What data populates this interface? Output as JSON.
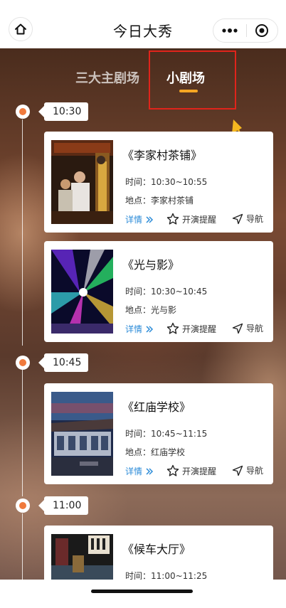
{
  "header": {
    "title": "今日大秀",
    "home_icon": "home-icon",
    "more_icon": "more-dots-icon",
    "close_icon": "target-close-icon"
  },
  "tabs": {
    "main_label": "三大主剧场",
    "small_label": "小剧场",
    "active": "small",
    "accent": "#f5a623"
  },
  "annotation": {
    "box_color": "#e0241b",
    "arrow_color": "#f5b820"
  },
  "timeline": {
    "slots": [
      {
        "time": "10:30"
      },
      {
        "time": "10:45"
      },
      {
        "time": "11:00"
      }
    ]
  },
  "shows": [
    {
      "title": "《李家村茶铺》",
      "time_label": "时间：",
      "time_value": "10:30~10:55",
      "place_label": "地点：",
      "place_value": "李家村茶铺",
      "detail": "详情",
      "remind": "开演提醒",
      "navigate": "导航"
    },
    {
      "title": "《光与影》",
      "time_label": "时间：",
      "time_value": "10:30~10:45",
      "place_label": "地点：",
      "place_value": "光与影",
      "detail": "详情",
      "remind": "开演提醒",
      "navigate": "导航"
    },
    {
      "title": "《红庙学校》",
      "time_label": "时间：",
      "time_value": "10:45~11:15",
      "place_label": "地点：",
      "place_value": "红庙学校",
      "detail": "详情",
      "remind": "开演提醒",
      "navigate": "导航"
    },
    {
      "title": "《候车大厅》",
      "time_label": "时间：",
      "time_value": "11:00~11:25"
    }
  ],
  "colors": {
    "detail_link": "#2b8bd8",
    "timeline_dot": "#f07a3c"
  }
}
